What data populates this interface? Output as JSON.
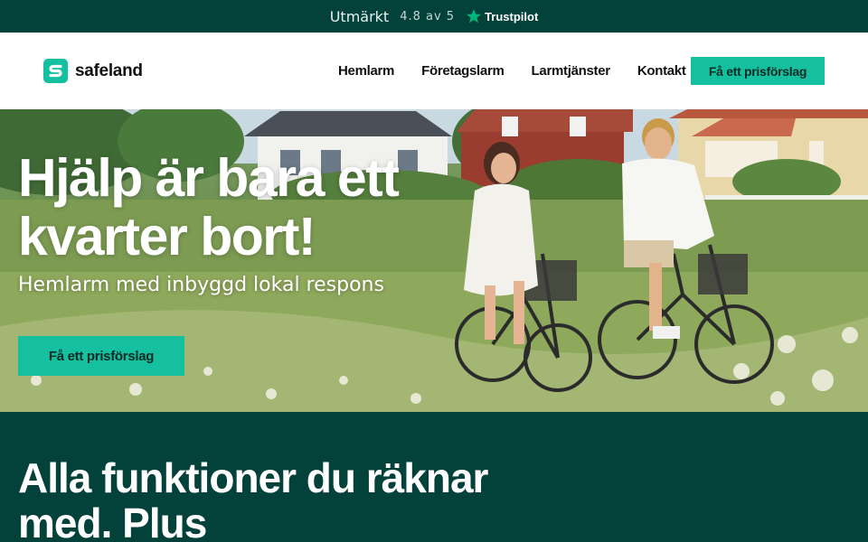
{
  "trustbar": {
    "rating_word": "Utmärkt",
    "score": "4.8 av 5",
    "brand": "Trustpilot"
  },
  "header": {
    "logo_text": "safeland",
    "nav": [
      {
        "label": "Hemlarm"
      },
      {
        "label": "Företagslarm"
      },
      {
        "label": "Larmtjänster"
      },
      {
        "label": "Kontakt"
      }
    ],
    "cta_label": "Få ett prisförslag"
  },
  "hero": {
    "title": "Hjälp är bara ett kvarter bort!",
    "subtitle": "Hemlarm med inbyggd lokal respons",
    "cta_label": "Få ett prisförslag",
    "image": "two people cycling through a meadow in front of houses"
  },
  "features": {
    "title": "Alla funktioner du räknar med. Plus"
  },
  "colors": {
    "brand_dark": "#03423a",
    "accent": "#14c09f",
    "trustpilot_green": "#00b67a"
  },
  "icons": {
    "trust_star": "star-icon",
    "logo": "safeland-logo-icon"
  }
}
